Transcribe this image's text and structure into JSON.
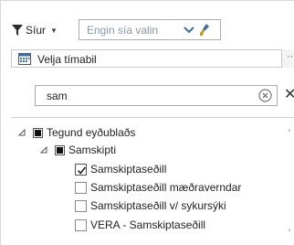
{
  "toolbar": {
    "filter_label": "Síur",
    "filter_icon": "funnel-icon",
    "saved_filter_placeholder": "Engin sía valin",
    "brush_icon": "clear-brush-icon"
  },
  "date_range": {
    "label": "Velja tímabil",
    "more_label": "···",
    "icon": "calendar-icon"
  },
  "search": {
    "value": "sam"
  },
  "tree": {
    "root": {
      "label": "Tegund eyðublaðs",
      "state": "partial",
      "expanded": true
    },
    "group": {
      "label": "Samskipti",
      "state": "partial",
      "expanded": true
    },
    "items": [
      {
        "label": "Samskiptaseðill",
        "checked": true
      },
      {
        "label": "Samskiptaseðill mæðraverndar",
        "checked": false
      },
      {
        "label": "Samskiptaseðill v/ sykursýki",
        "checked": false
      },
      {
        "label": "VERA - Samskiptaseðill",
        "checked": false
      }
    ]
  },
  "colors": {
    "placeholder": "#8a97a8",
    "accent": "#3b6ea5",
    "border": "#ababab"
  }
}
